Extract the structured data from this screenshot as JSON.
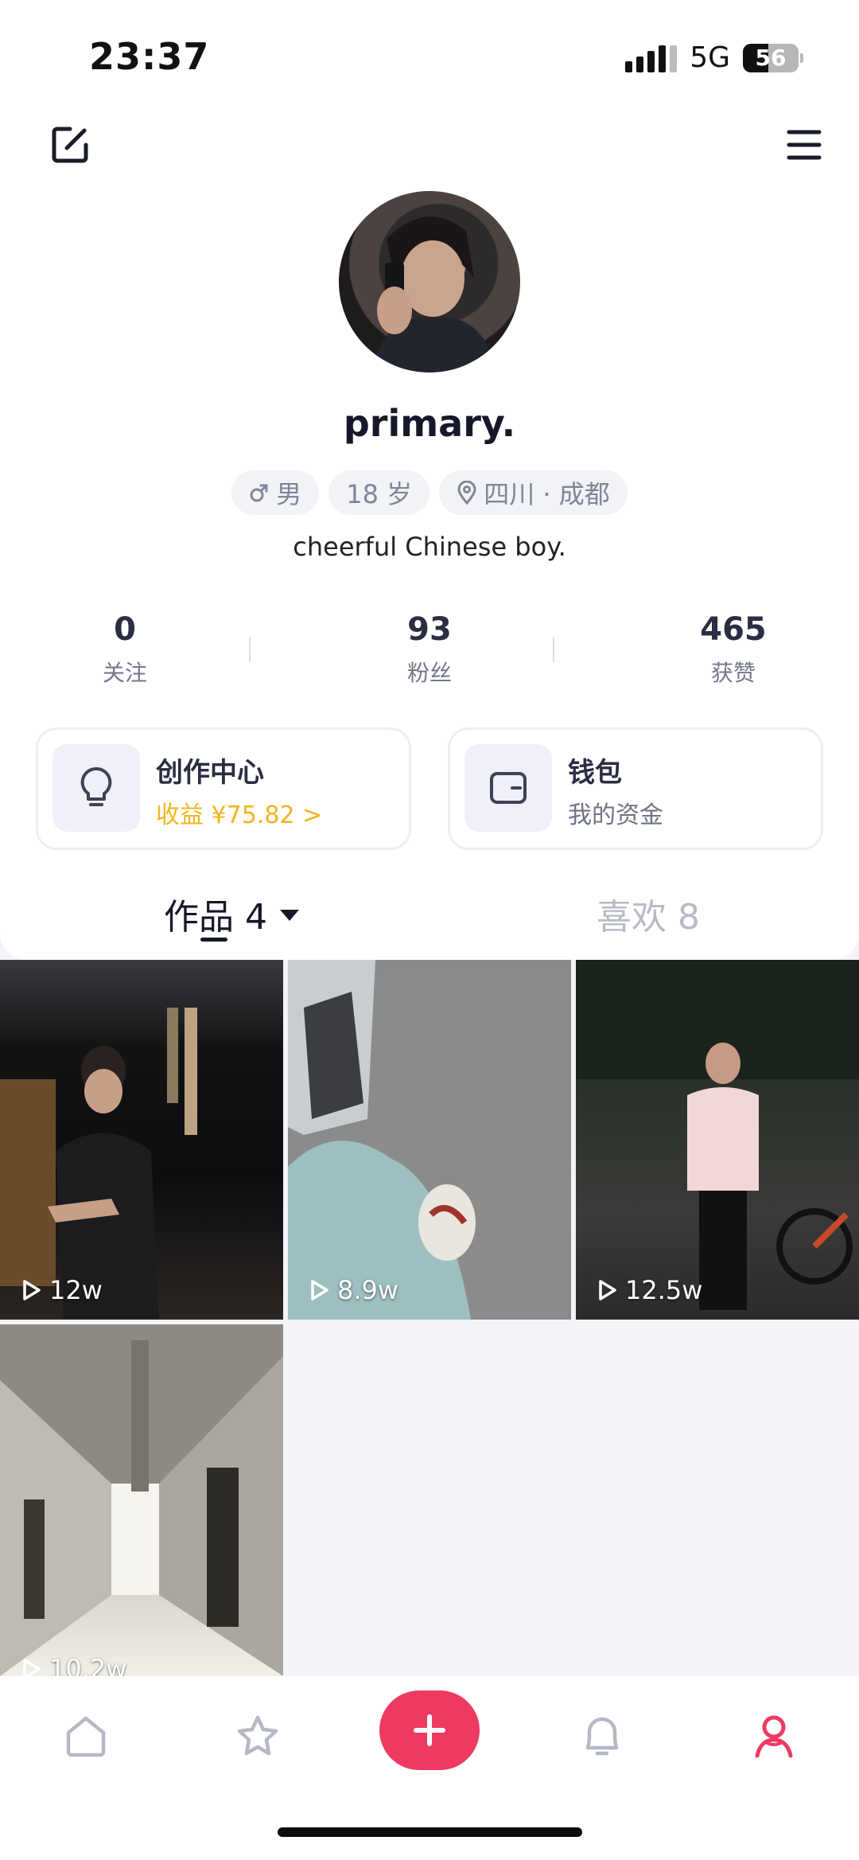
{
  "status_bar": {
    "time": "23:37",
    "network": "5G",
    "battery": "56"
  },
  "profile": {
    "username": "primary.",
    "tags": [
      {
        "icon": "male-icon",
        "label": "男"
      },
      {
        "icon": "",
        "label": "18 岁"
      },
      {
        "icon": "location-pin-icon",
        "label": "四川 · 成都"
      }
    ],
    "bio": "cheerful Chinese boy."
  },
  "stats": [
    {
      "value": "0",
      "label": "关注"
    },
    {
      "value": "93",
      "label": "粉丝"
    },
    {
      "value": "465",
      "label": "获赞"
    }
  ],
  "cards": {
    "creator": {
      "title": "创作中心",
      "subtitle": "收益 ¥75.82 >"
    },
    "wallet": {
      "title": "钱包",
      "subtitle": "我的资金"
    }
  },
  "tabs": {
    "works": "作品 4",
    "likes": "喜欢 8"
  },
  "videos": [
    {
      "views": "12w"
    },
    {
      "views": "8.9w"
    },
    {
      "views": "12.5w"
    },
    {
      "views": "10.2w"
    }
  ],
  "colors": {
    "accent": "#ee3a62",
    "gold": "#f2b51f"
  },
  "bottom_nav": [
    "home-icon",
    "star-icon",
    "add-icon",
    "bell-icon",
    "profile-icon"
  ]
}
